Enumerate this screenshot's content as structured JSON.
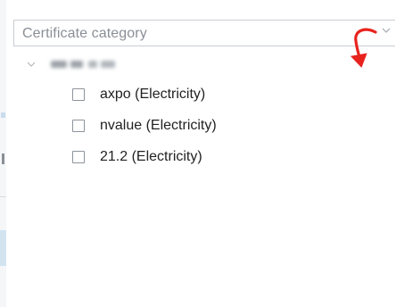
{
  "select": {
    "placeholder": "Certificate category"
  },
  "tree": {
    "root_label_blurred": true,
    "items": [
      {
        "label": "axpo (Electricity)",
        "checked": false
      },
      {
        "label": "nvalue (Electricity)",
        "checked": false
      },
      {
        "label": "21.2 (Electricity)",
        "checked": false
      }
    ]
  },
  "icons": {
    "chevron": "chevron-down-icon",
    "toggle": "tree-expand-icon",
    "annotation": "red-curved-arrow"
  },
  "colors": {
    "annotation_arrow": "#e8231e",
    "border": "#c9cdd2",
    "placeholder_text": "#8a8f96",
    "item_text": "#222222"
  }
}
